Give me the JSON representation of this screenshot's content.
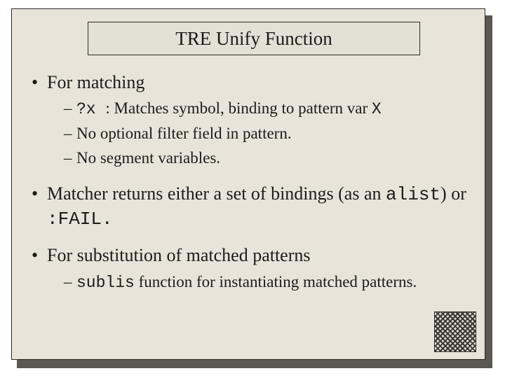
{
  "title": "TRE Unify Function",
  "bullets": [
    {
      "text": "For matching",
      "subs": [
        {
          "code_prefix": "?x ",
          "after": " : Matches symbol, binding to pattern var ",
          "code_suffix": "X"
        },
        {
          "plain": "No optional filter field in pattern."
        },
        {
          "plain": "No segment variables."
        }
      ]
    },
    {
      "runs": [
        {
          "t": "Matcher returns either a set of bindings (as an "
        },
        {
          "t": "alist",
          "mono": true
        },
        {
          "t": ") or "
        },
        {
          "t": ":FAIL.",
          "mono": true
        }
      ]
    },
    {
      "text": "For substitution of matched patterns",
      "subs": [
        {
          "code_prefix": "sublis",
          "after": " function for instantiating matched patterns."
        }
      ]
    }
  ]
}
